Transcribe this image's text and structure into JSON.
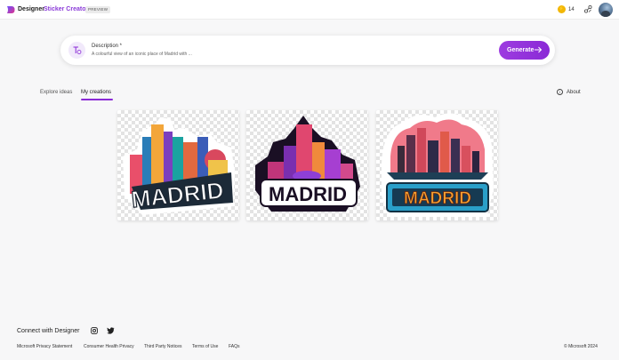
{
  "header": {
    "brand": "Designer",
    "app_name": "Sticker Creator",
    "badge": "PREVIEW",
    "coins": "14",
    "coin_icon": "coin-icon",
    "share_icon": "share-icon"
  },
  "prompt": {
    "label": "Description *",
    "value": "A colourful view of an iconic place of Madrid with ...",
    "generate_label": "Generate",
    "accent": "#8a2ad6"
  },
  "tabs": [
    {
      "label": "Explore ideas",
      "active": false
    },
    {
      "label": "My creations",
      "active": true
    }
  ],
  "about_label": "About",
  "creations": [
    {
      "text": "MADRID",
      "style": "cityscape-teal"
    },
    {
      "text": "MADRID",
      "style": "skyline-purple"
    },
    {
      "text": "MADRID",
      "style": "sunset-ornate"
    }
  ],
  "footer": {
    "connect": "Connect with Designer",
    "links": [
      "Microsoft Privacy Statement",
      "Consumer Health Privacy",
      "Third Party Notices",
      "Terms of Use",
      "FAQs"
    ],
    "copyright": "© Microsoft 2024"
  }
}
